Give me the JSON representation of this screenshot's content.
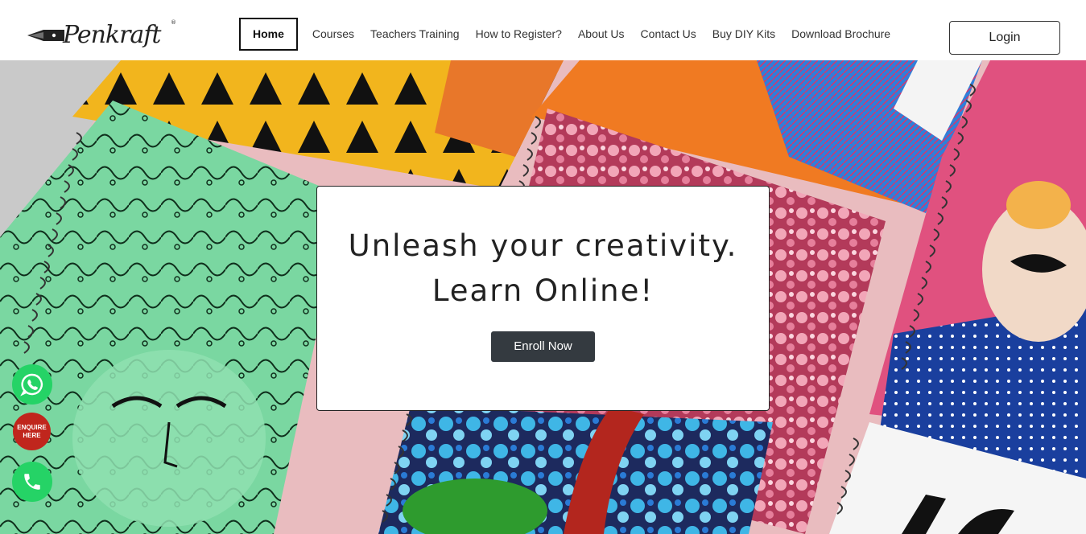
{
  "brand": {
    "name": "Penkraft",
    "reg_mark": "®"
  },
  "nav": {
    "items": [
      {
        "label": "Home",
        "active": true
      },
      {
        "label": "Courses",
        "active": false
      },
      {
        "label": "Teachers Training",
        "active": false
      },
      {
        "label": "How to Register?",
        "active": false
      },
      {
        "label": "About Us",
        "active": false
      },
      {
        "label": "Contact Us",
        "active": false
      },
      {
        "label": "Buy DIY Kits",
        "active": false
      },
      {
        "label": "Download Brochure",
        "active": false
      }
    ],
    "login_label": "Login"
  },
  "hero": {
    "headline_line1": "Unleash your creativity.",
    "headline_line2": "Learn Online!",
    "cta_label": "Enroll Now"
  },
  "floating": {
    "whatsapp_icon": "whatsapp-icon",
    "enquire_line1": "ENQUIRE",
    "enquire_line2": "HERE",
    "phone_icon": "phone-icon"
  },
  "colors": {
    "hero_bg": "#e9bcbf",
    "cta_bg": "#343a40",
    "whatsapp": "#25d366",
    "enquire": "#c0261d"
  }
}
